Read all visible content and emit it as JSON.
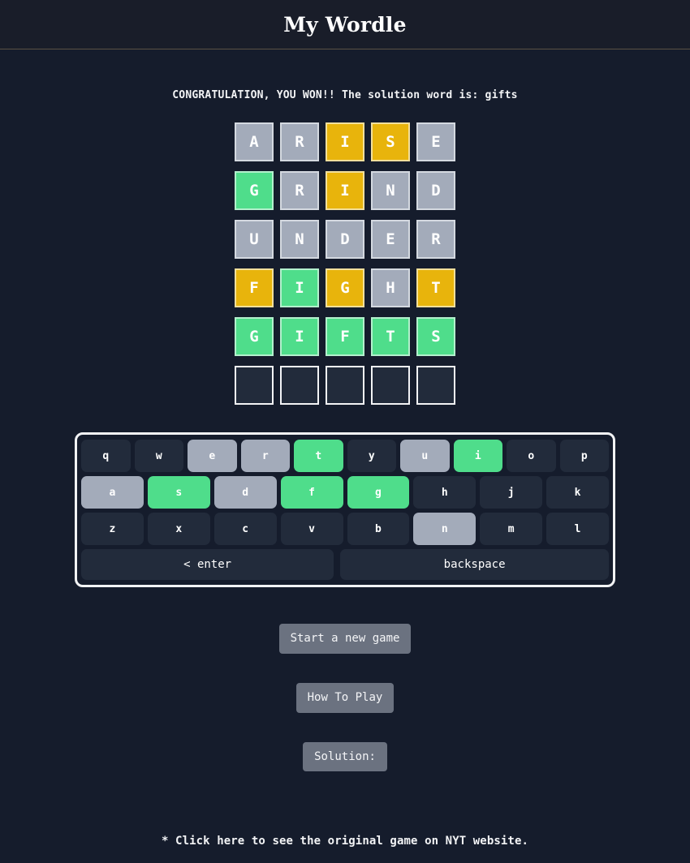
{
  "header": {
    "title": "My Wordle"
  },
  "status": {
    "message": "CONGRATULATION, YOU WON!! The solution word is: gifts"
  },
  "colors": {
    "page_background": "#151c2c",
    "header_background": "#191d29",
    "header_divider": "#5c5243",
    "tile_empty": "#222b3b",
    "tile_absent": "#a3abba",
    "tile_present": "#e8b40c",
    "tile_correct": "#4fdd8b",
    "key_default": "#222b3b",
    "button_background": "#6b7280",
    "text": "#ffffff"
  },
  "board": {
    "solution": "gifts",
    "rows": [
      {
        "word": "ARISE",
        "tiles": [
          {
            "letter": "A",
            "state": "absent"
          },
          {
            "letter": "R",
            "state": "absent"
          },
          {
            "letter": "I",
            "state": "present"
          },
          {
            "letter": "S",
            "state": "present"
          },
          {
            "letter": "E",
            "state": "absent"
          }
        ]
      },
      {
        "word": "GRIND",
        "tiles": [
          {
            "letter": "G",
            "state": "correct"
          },
          {
            "letter": "R",
            "state": "absent"
          },
          {
            "letter": "I",
            "state": "present"
          },
          {
            "letter": "N",
            "state": "absent"
          },
          {
            "letter": "D",
            "state": "absent"
          }
        ]
      },
      {
        "word": "UNDER",
        "tiles": [
          {
            "letter": "U",
            "state": "absent"
          },
          {
            "letter": "N",
            "state": "absent"
          },
          {
            "letter": "D",
            "state": "absent"
          },
          {
            "letter": "E",
            "state": "absent"
          },
          {
            "letter": "R",
            "state": "absent"
          }
        ]
      },
      {
        "word": "FIGHT",
        "tiles": [
          {
            "letter": "F",
            "state": "present"
          },
          {
            "letter": "I",
            "state": "correct"
          },
          {
            "letter": "G",
            "state": "present"
          },
          {
            "letter": "H",
            "state": "absent"
          },
          {
            "letter": "T",
            "state": "present"
          }
        ]
      },
      {
        "word": "GIFTS",
        "tiles": [
          {
            "letter": "G",
            "state": "correct"
          },
          {
            "letter": "I",
            "state": "correct"
          },
          {
            "letter": "F",
            "state": "correct"
          },
          {
            "letter": "T",
            "state": "correct"
          },
          {
            "letter": "S",
            "state": "correct"
          }
        ]
      },
      {
        "word": "",
        "tiles": [
          {
            "letter": "",
            "state": "empty"
          },
          {
            "letter": "",
            "state": "empty"
          },
          {
            "letter": "",
            "state": "empty"
          },
          {
            "letter": "",
            "state": "empty"
          },
          {
            "letter": "",
            "state": "empty"
          }
        ]
      }
    ]
  },
  "keyboard": {
    "rows": [
      [
        {
          "key": "q",
          "state": "default"
        },
        {
          "key": "w",
          "state": "default"
        },
        {
          "key": "e",
          "state": "absent"
        },
        {
          "key": "r",
          "state": "absent"
        },
        {
          "key": "t",
          "state": "correct"
        },
        {
          "key": "y",
          "state": "default"
        },
        {
          "key": "u",
          "state": "absent"
        },
        {
          "key": "i",
          "state": "correct"
        },
        {
          "key": "o",
          "state": "default"
        },
        {
          "key": "p",
          "state": "default"
        }
      ],
      [
        {
          "key": "a",
          "state": "absent"
        },
        {
          "key": "s",
          "state": "correct"
        },
        {
          "key": "d",
          "state": "absent"
        },
        {
          "key": "f",
          "state": "correct"
        },
        {
          "key": "g",
          "state": "correct"
        },
        {
          "key": "h",
          "state": "default"
        },
        {
          "key": "j",
          "state": "default"
        },
        {
          "key": "k",
          "state": "default"
        }
      ],
      [
        {
          "key": "z",
          "state": "default"
        },
        {
          "key": "x",
          "state": "default"
        },
        {
          "key": "c",
          "state": "default"
        },
        {
          "key": "v",
          "state": "default"
        },
        {
          "key": "b",
          "state": "default"
        },
        {
          "key": "n",
          "state": "absent"
        },
        {
          "key": "m",
          "state": "default"
        },
        {
          "key": "l",
          "state": "default"
        }
      ]
    ],
    "enter_label": "< enter",
    "backspace_label": "backspace"
  },
  "actions": {
    "new_game_label": "Start a new game",
    "how_to_play_label": "How To Play",
    "solution_label": "Solution:"
  },
  "footer": {
    "note": "* Click here to see the original game on NYT website."
  }
}
